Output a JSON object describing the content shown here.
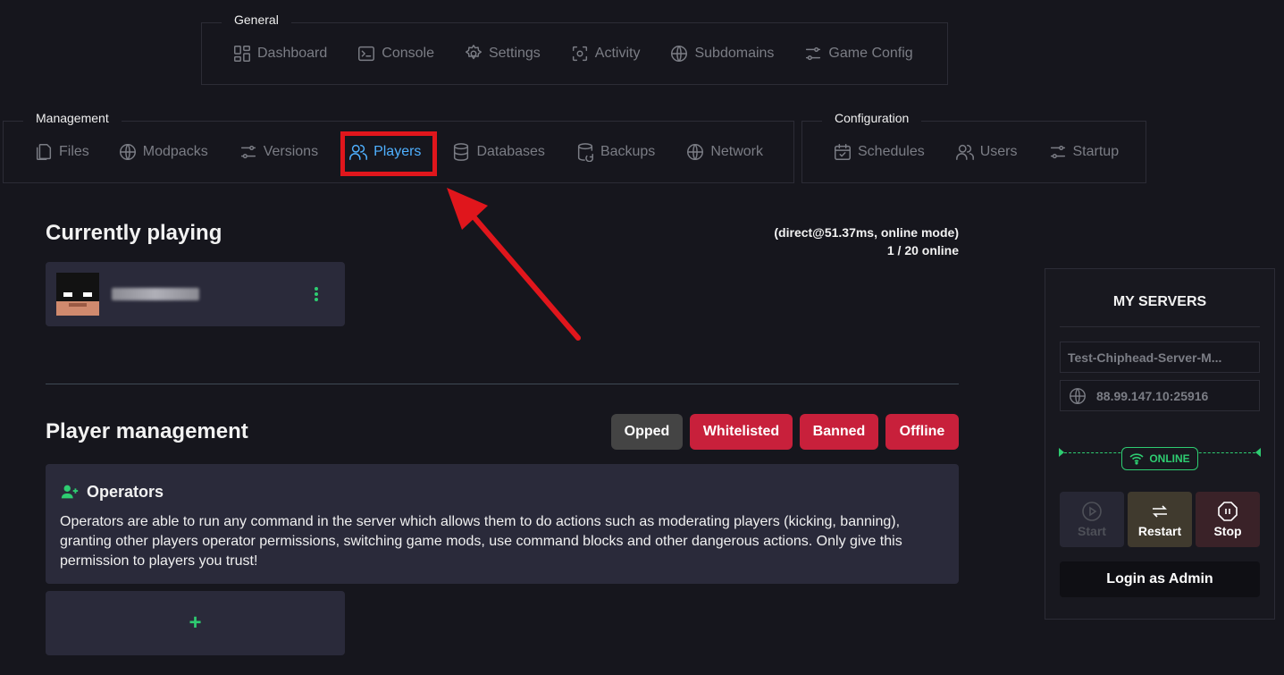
{
  "nav": {
    "general": {
      "legend": "General",
      "items": [
        {
          "label": "Dashboard",
          "icon": "dashboard-icon"
        },
        {
          "label": "Console",
          "icon": "console-icon"
        },
        {
          "label": "Settings",
          "icon": "gear-icon"
        },
        {
          "label": "Activity",
          "icon": "activity-icon"
        },
        {
          "label": "Subdomains",
          "icon": "globe-icon"
        },
        {
          "label": "Game Config",
          "icon": "sliders-icon"
        }
      ]
    },
    "management": {
      "legend": "Management",
      "items": [
        {
          "label": "Files",
          "icon": "files-icon"
        },
        {
          "label": "Modpacks",
          "icon": "globe-icon"
        },
        {
          "label": "Versions",
          "icon": "sliders-icon"
        },
        {
          "label": "Players",
          "icon": "users-icon",
          "active": true
        },
        {
          "label": "Databases",
          "icon": "database-icon"
        },
        {
          "label": "Backups",
          "icon": "backup-icon"
        },
        {
          "label": "Network",
          "icon": "globe-icon"
        }
      ]
    },
    "configuration": {
      "legend": "Configuration",
      "items": [
        {
          "label": "Schedules",
          "icon": "calendar-icon"
        },
        {
          "label": "Users",
          "icon": "users-icon"
        },
        {
          "label": "Startup",
          "icon": "sliders-icon"
        }
      ]
    }
  },
  "playing": {
    "title": "Currently playing",
    "connection": "(direct@51.37ms, online mode)",
    "online_count": "1 / 20 online"
  },
  "management": {
    "title": "Player management",
    "filters": [
      "Opped",
      "Whitelisted",
      "Banned",
      "Offline"
    ],
    "operators_title": "Operators",
    "operators_desc": "Operators are able to run any command in the server which allows them to do actions such as moderating players (kicking, banning), granting other players operator permissions, switching game mods, use command blocks and other dangerous actions. Only give this permission to players you trust!",
    "add_label": "+"
  },
  "sidebar": {
    "title": "MY SERVERS",
    "server_name": "Test-Chiphead-Server-M...",
    "address": "88.99.147.10:25916",
    "status": "ONLINE",
    "start_label": "Start",
    "restart_label": "Restart",
    "stop_label": "Stop",
    "login_label": "Login as Admin"
  },
  "colors": {
    "accent_blue": "#4fb0ff",
    "highlight_red": "#e0161c",
    "online_green": "#2ecc71",
    "filter_red": "#c8203b"
  }
}
